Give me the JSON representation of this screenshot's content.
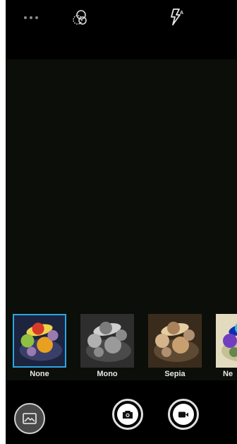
{
  "top_bar": {
    "icons": [
      "more-options-icon",
      "filter-effects-icon",
      "flash-auto-icon"
    ]
  },
  "filters": [
    {
      "label": "None",
      "selected": true,
      "tone": "color"
    },
    {
      "label": "Mono",
      "selected": false,
      "tone": "mono"
    },
    {
      "label": "Sepia",
      "selected": false,
      "tone": "sepia"
    },
    {
      "label": "Ne",
      "selected": false,
      "tone": "negative"
    }
  ],
  "bottom_bar": {
    "icons": [
      "gallery-icon",
      "camera-shutter-icon",
      "video-record-icon"
    ]
  },
  "colors": {
    "selection": "#2aa6e0",
    "viewfinder": "#0c0e09"
  }
}
